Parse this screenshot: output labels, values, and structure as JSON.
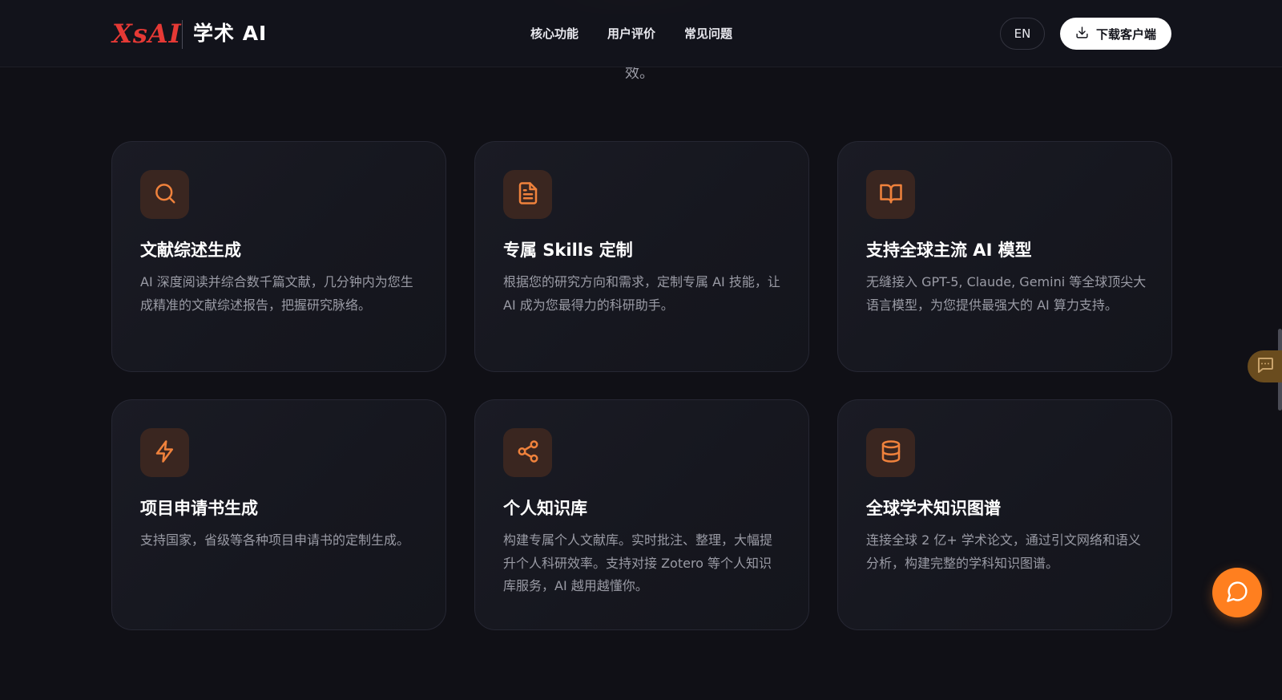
{
  "brand": {
    "logo_mark": "XsAI",
    "name": "学术 AI"
  },
  "nav": {
    "items": [
      {
        "label": "核心功能"
      },
      {
        "label": "用户评价"
      },
      {
        "label": "常见问题"
      }
    ]
  },
  "header_actions": {
    "lang_label": "EN",
    "download_label": "下载客户端"
  },
  "intro": {
    "tail_text": "效。"
  },
  "features": [
    {
      "icon": "search-icon",
      "title": "文献综述生成",
      "desc": "AI 深度阅读并综合数千篇文献，几分钟内为您生成精准的文献综述报告，把握研究脉络。"
    },
    {
      "icon": "document-icon",
      "title": "专属 Skills 定制",
      "desc": "根据您的研究方向和需求，定制专属 AI 技能，让 AI 成为您最得力的科研助手。"
    },
    {
      "icon": "book-open-icon",
      "title": "支持全球主流 AI 模型",
      "desc": "无缝接入 GPT-5, Claude, Gemini 等全球顶尖大语言模型，为您提供最强大的 AI 算力支持。"
    },
    {
      "icon": "lightning-icon",
      "title": "项目申请书生成",
      "desc": "支持国家，省级等各种项目申请书的定制生成。"
    },
    {
      "icon": "share-icon",
      "title": "个人知识库",
      "desc": "构建专属个人文献库。实时批注、整理，大幅提升个人科研效率。支持对接 Zotero 等个人知识库服务，AI 越用越懂你。"
    },
    {
      "icon": "database-icon",
      "title": "全球学术知识图谱",
      "desc": "连接全球 2 亿+ 学术论文，通过引文网络和语义分析，构建完整的学科知识图谱。"
    }
  ],
  "floating": {
    "feedback_icon": "message-dots-icon",
    "chat_icon": "chat-bubble-icon"
  },
  "colors": {
    "accent": "#ff7f1f",
    "icon_tint": "#f0823c",
    "logo_red": "#e53935",
    "background": "#101016",
    "card_border": "#262733"
  }
}
